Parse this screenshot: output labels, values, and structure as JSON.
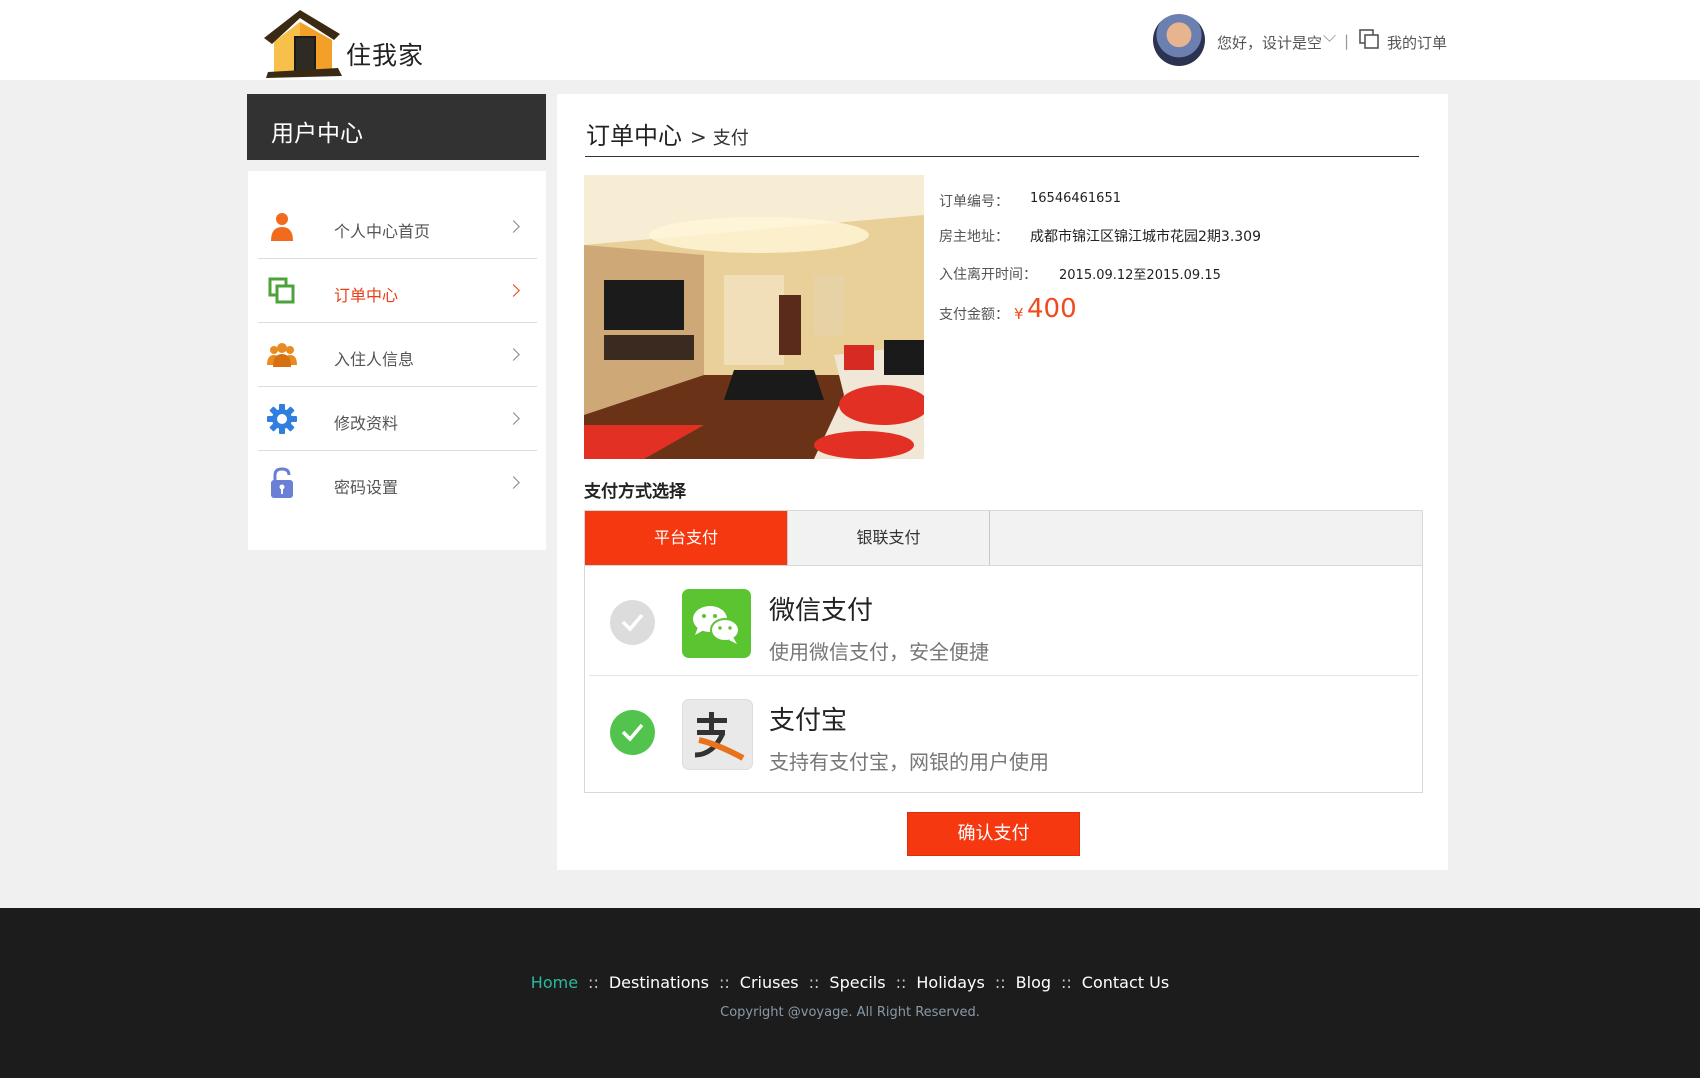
{
  "header": {
    "logo_text": "住我家",
    "greeting": "您好，设计是空",
    "separator": "|",
    "my_orders": "我的订单"
  },
  "sidebar": {
    "title": "用户中心",
    "items": [
      {
        "label": "个人中心首页",
        "icon": "person-icon",
        "color": "#f26a1b"
      },
      {
        "label": "订单中心",
        "icon": "orders-icon",
        "color": "#4ca33a",
        "active": true
      },
      {
        "label": "入住人信息",
        "icon": "users-icon",
        "color": "#e98a22"
      },
      {
        "label": "修改资料",
        "icon": "gear-icon",
        "color": "#2f7ee0"
      },
      {
        "label": "密码设置",
        "icon": "lock-icon",
        "color": "#6a7fd6"
      }
    ]
  },
  "breadcrumb": {
    "main": "订单中心",
    "separator": ">",
    "current": "支付"
  },
  "order": {
    "number_label": "订单编号：",
    "number_value": "16546461651",
    "address_label": "房主地址：",
    "address_value": "成都市锦江区锦江城市花园2期3.309",
    "dates_label": "入住离开时间：",
    "dates_value": "2015.09.12至2015.09.15",
    "amount_label": "支付金额：",
    "currency": "¥",
    "amount_value": "400"
  },
  "payment": {
    "section_title": "支付方式选择",
    "tabs": [
      "平台支付",
      "银联支付"
    ],
    "methods": [
      {
        "name": "微信支付",
        "desc": "使用微信支付，安全便捷",
        "selected": false,
        "icon": "wechat-icon"
      },
      {
        "name": "支付宝",
        "desc": "支持有支付宝，网银的用户使用",
        "selected": true,
        "icon": "alipay-icon"
      }
    ],
    "confirm_label": "确认支付"
  },
  "footer": {
    "nav": [
      "Home",
      "Destinations",
      "Criuses",
      "Specils",
      "Holidays",
      "Blog",
      "Contact Us"
    ],
    "nav_sep": "::",
    "copyright": "Copyright @voyage. All Right Reserved."
  },
  "colors": {
    "accent": "#f5380f",
    "active_link": "#e8401a",
    "footer_home": "#2bb9a0"
  }
}
